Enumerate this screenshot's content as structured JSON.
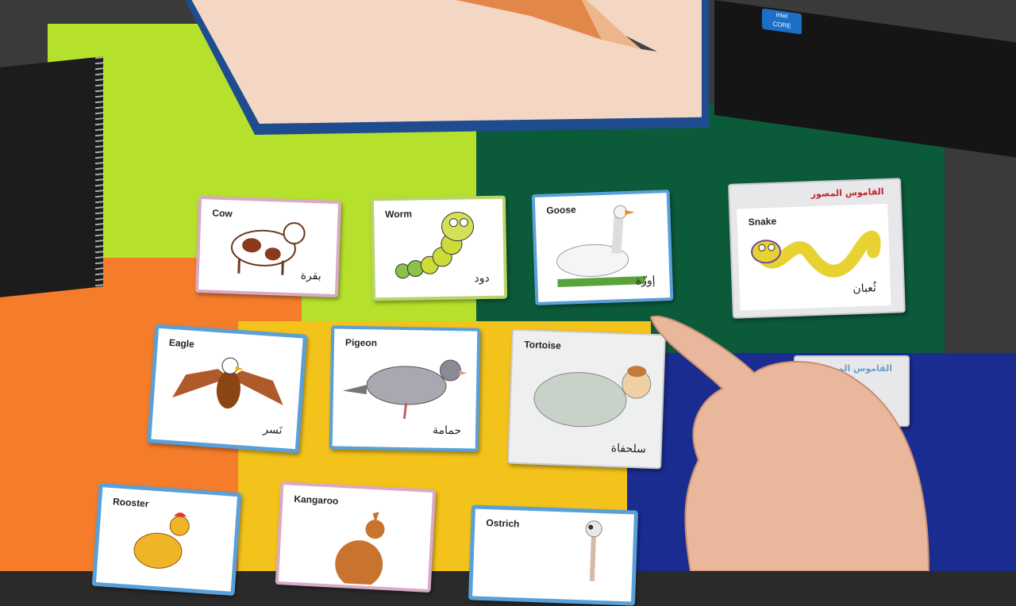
{
  "scene": {
    "laptop_badge": {
      "brand": "intel",
      "line": "CORE"
    },
    "dictionary_header": "القاموس المصور",
    "dictionary_header_partial": "القاموس الم"
  },
  "cards": [
    {
      "english": "Cow",
      "arabic": "بقرة",
      "icon": "cow-icon"
    },
    {
      "english": "Worm",
      "arabic": "دود",
      "icon": "worm-icon"
    },
    {
      "english": "Goose",
      "arabic": "إوزّة",
      "icon": "goose-icon"
    },
    {
      "english": "Snake",
      "arabic": "ثُعبان",
      "icon": "snake-icon"
    },
    {
      "english": "Eagle",
      "arabic": "نَسر",
      "icon": "eagle-icon"
    },
    {
      "english": "Pigeon",
      "arabic": "حمامة",
      "icon": "pigeon-icon"
    },
    {
      "english": "Tortoise",
      "arabic": "سلحفاة",
      "icon": "tortoise-icon"
    },
    {
      "english": "Rooster",
      "arabic": "",
      "icon": "rooster-icon"
    },
    {
      "english": "Kangaroo",
      "arabic": "",
      "icon": "kangaroo-icon"
    },
    {
      "english": "Ostrich",
      "arabic": "",
      "icon": "ostrich-icon"
    }
  ],
  "colors": {
    "felt_lime": "#b5e12c",
    "felt_green": "#0b5a3a",
    "felt_orange": "#f47c2a",
    "felt_yellow": "#f3c21b",
    "felt_blue": "#1a2c8f",
    "card_border_blue": "#5aa0d8",
    "card_border_pink": "#d9a9c6",
    "card_border_green": "#b8d56a"
  }
}
